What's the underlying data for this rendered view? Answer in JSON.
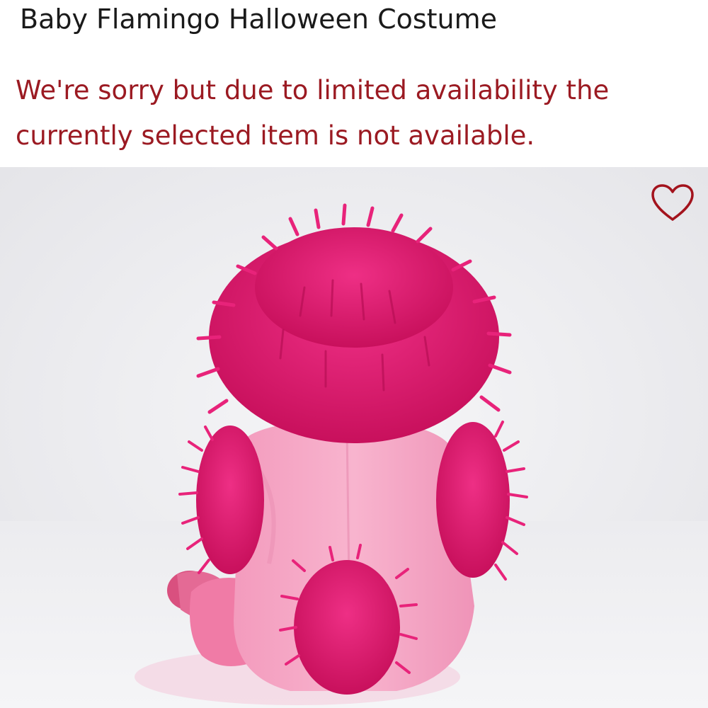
{
  "product": {
    "title": "Baby Flamingo Halloween Costume",
    "availability_notice": "We're sorry but due to limited availability the currently selected item is not available."
  },
  "image": {
    "subject": "Baby Flamingo Halloween Costume",
    "colors": {
      "background": "#f1f1f3",
      "fur": "#e8237a",
      "fur_dark": "#c9125f",
      "body": "#f7a8c6",
      "body_shade": "#ee93b7",
      "foot": "#d9507f"
    }
  },
  "favorite": {
    "icon": "heart-outline-icon",
    "color": "#a3131d"
  },
  "colors": {
    "notice": "#9b1a22",
    "title": "#1a1a1a"
  }
}
